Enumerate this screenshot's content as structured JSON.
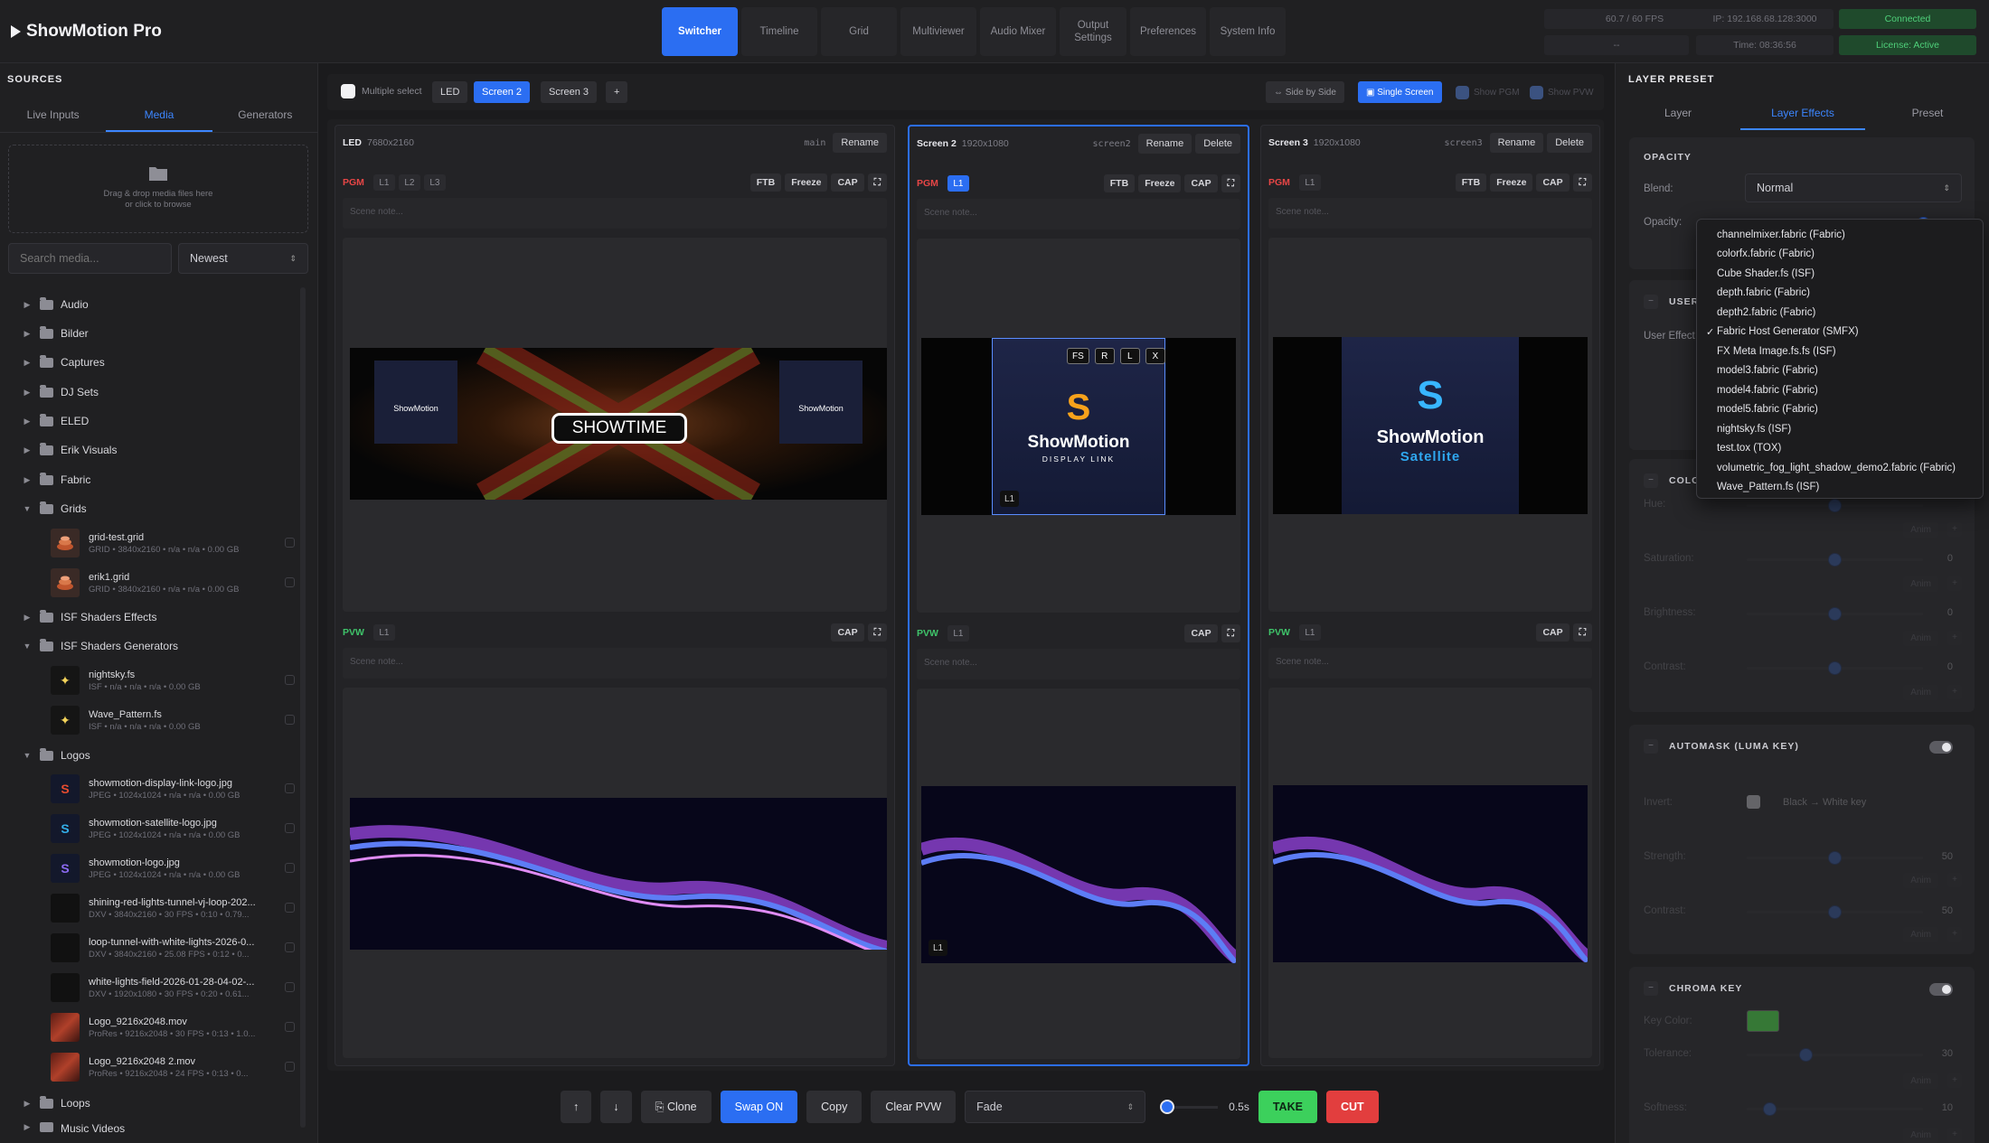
{
  "app": {
    "title": "ShowMotion Pro"
  },
  "nav": {
    "tabs": [
      "Switcher",
      "Timeline",
      "Grid",
      "Multiviewer",
      "Audio Mixer",
      "Output Settings",
      "Preferences",
      "System Info"
    ],
    "active": "Switcher"
  },
  "status": {
    "fps": "60.7 / 60 FPS",
    "ip": "IP: 192.168.68.128:3000",
    "connection": "Connected",
    "placeholder": "--",
    "time": "Time: 08:36:56",
    "license": "License: Active"
  },
  "sources": {
    "title": "SOURCES",
    "tabs": [
      "Live Inputs",
      "Media",
      "Generators"
    ],
    "active_tab": "Media",
    "drop_text_1": "Drag & drop media files here",
    "drop_text_2": "or click to browse",
    "search_placeholder": "Search media...",
    "sort": "Newest",
    "folders_top": [
      "Audio",
      "Bilder",
      "Captures",
      "DJ Sets",
      "ELED",
      "Erik Visuals",
      "Fabric",
      "Grids"
    ],
    "grids_files": [
      {
        "name": "grid-test.grid",
        "meta": "GRID • 3840x2160 • n/a • n/a • 0.00 GB"
      },
      {
        "name": "erik1.grid",
        "meta": "GRID • 3840x2160 • n/a • n/a • 0.00 GB"
      }
    ],
    "folder_isf_effects": "ISF Shaders Effects",
    "folder_isf_generators": "ISF Shaders Generators",
    "isf_files": [
      {
        "name": "nightsky.fs",
        "meta": "ISF • n/a • n/a • n/a • 0.00 GB"
      },
      {
        "name": "Wave_Pattern.fs",
        "meta": "ISF • n/a • n/a • n/a • 0.00 GB"
      }
    ],
    "folder_logos": "Logos",
    "logo_files": [
      {
        "name": "showmotion-display-link-logo.jpg",
        "meta": "JPEG • 1024x1024 • n/a • n/a • 0.00 GB"
      },
      {
        "name": "showmotion-satellite-logo.jpg",
        "meta": "JPEG • 1024x1024 • n/a • n/a • 0.00 GB"
      },
      {
        "name": "showmotion-logo.jpg",
        "meta": "JPEG • 1024x1024 • n/a • n/a • 0.00 GB"
      },
      {
        "name": "shining-red-lights-tunnel-vj-loop-202...",
        "meta": "DXV • 3840x2160 • 30 FPS • 0:10 • 0.79..."
      },
      {
        "name": "loop-tunnel-with-white-lights-2026-0...",
        "meta": "DXV • 3840x2160 • 25.08 FPS • 0:12 • 0..."
      },
      {
        "name": "white-lights-field-2026-01-28-04-02-...",
        "meta": "DXV • 1920x1080 • 30 FPS • 0:20 • 0.61..."
      },
      {
        "name": "Logo_9216x2048.mov",
        "meta": "ProRes • 9216x2048 • 30 FPS • 0:13 • 1.0..."
      },
      {
        "name": "Logo_9216x2048 2.mov",
        "meta": "ProRes • 9216x2048 • 24 FPS • 0:13 • 0..."
      }
    ],
    "folder_loops": "Loops",
    "folder_music": "Music Videos"
  },
  "switcher": {
    "multiple_select": "Multiple select",
    "screen_tabs": [
      "LED",
      "Screen 2",
      "Screen 3"
    ],
    "add": "+",
    "side_by_side": "⇔ Side by Side",
    "single_screen": "▣ Single Screen",
    "show_pgm": "Show PGM",
    "show_pvw": "Show PVW",
    "screens": [
      {
        "name": "LED",
        "res": "7680x2160",
        "id": "main",
        "rename": "Rename",
        "delete": "",
        "pgm_layers": [
          "L1",
          "L2",
          "L3"
        ],
        "pvw_layers": [
          "L1"
        ]
      },
      {
        "name": "Screen 2",
        "res": "1920x1080",
        "id": "screen2",
        "rename": "Rename",
        "delete": "Delete",
        "pgm_layers": [
          "L1"
        ],
        "pvw_layers": [
          "L1"
        ]
      },
      {
        "name": "Screen 3",
        "res": "1920x1080",
        "id": "screen3",
        "rename": "Rename",
        "delete": "Delete",
        "pgm_layers": [
          "L1"
        ],
        "pvw_layers": [
          "L1"
        ]
      }
    ],
    "pgm": "PGM",
    "pvw": "PVW",
    "ftb": "FTB",
    "freeze": "Freeze",
    "cap": "CAP",
    "scene_note": "Scene note...",
    "showtime": "SHOWTIME",
    "logo_word": "ShowMotion",
    "display_link": "DISPLAY LINK",
    "satellite": "Satellite",
    "handles": [
      "FS",
      "R",
      "L",
      "X"
    ],
    "layer_tag": "L1"
  },
  "bottom": {
    "up": "↑",
    "down": "↓",
    "clone": "⎘ Clone",
    "swap": "Swap ON",
    "copy": "Copy",
    "clear": "Clear PVW",
    "transition": "Fade",
    "duration": "0.5s",
    "take": "TAKE",
    "cut": "CUT"
  },
  "layer_preset": {
    "title": "LAYER PRESET",
    "tabs": [
      "Layer",
      "Layer Effects",
      "Preset"
    ],
    "active_tab": "Layer Effects",
    "opacity_title": "OPACITY",
    "blend_label": "Blend:",
    "blend_value": "Normal",
    "opacity_label": "Opacity:",
    "user_title": "USER",
    "user_effect_label": "User Effect",
    "color_title": "COLOR",
    "hue": "Hue:",
    "saturation": "Saturation:",
    "brightness": "Brightness:",
    "contrast": "Contrast:",
    "zero": "0",
    "anim": "Anim",
    "plus": "+",
    "automask_title": "AUTOMASK (LUMA KEY)",
    "invert": "Invert:",
    "invert_hint": "Black → White key",
    "strength": "Strength:",
    "fifty": "50",
    "chroma_title": "CHROMA KEY",
    "key_color": "Key Color:",
    "tolerance": "Tolerance:",
    "tol_val": "30",
    "softness": "Softness:",
    "soft_val": "10",
    "key_color_hex": "#3e9b3c"
  },
  "effect_menu": {
    "items": [
      "channelmixer.fabric (Fabric)",
      "colorfx.fabric (Fabric)",
      "Cube Shader.fs (ISF)",
      "depth.fabric (Fabric)",
      "depth2.fabric (Fabric)",
      "Fabric Host Generator (SMFX)",
      "FX Meta Image.fs.fs (ISF)",
      "model3.fabric (Fabric)",
      "model4.fabric (Fabric)",
      "model5.fabric (Fabric)",
      "nightsky.fs (ISF)",
      "test.tox (TOX)",
      "volumetric_fog_light_shadow_demo2.fabric (Fabric)",
      "Wave_Pattern.fs (ISF)"
    ],
    "selected": "Fabric Host Generator (SMFX)",
    "checkmark": "✓"
  },
  "colors": {
    "accent": "#2b6ef2",
    "pgm": "#e84646",
    "pvw": "#3fc46a",
    "take": "#3cd05c",
    "cut": "#e23e3e"
  }
}
